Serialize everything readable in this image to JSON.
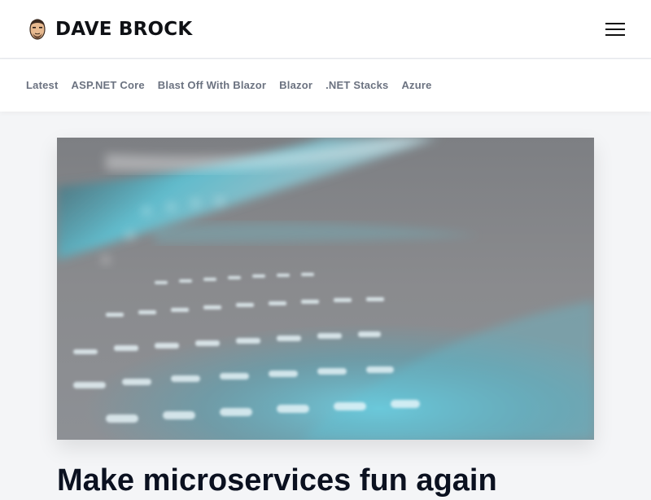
{
  "header": {
    "site_name": "DAVE BROCK",
    "logo_icon": "face-avatar-icon",
    "menu_icon": "hamburger-menu-icon"
  },
  "nav": {
    "items": [
      {
        "label": "Latest"
      },
      {
        "label": "ASP.NET Core"
      },
      {
        "label": "Blast Off With Blazor"
      },
      {
        "label": "Blazor"
      },
      {
        "label": ".NET Stacks"
      },
      {
        "label": "Azure"
      }
    ]
  },
  "featured_post": {
    "title": "Make microservices fun again"
  },
  "colors": {
    "accent_cyan": "#4fc3d9",
    "text_dark": "#0b1120",
    "nav_text": "#6b7280",
    "page_bg": "#f4f5f7"
  }
}
